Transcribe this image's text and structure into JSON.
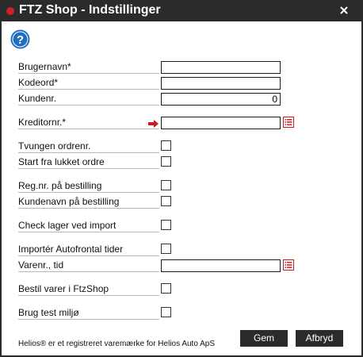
{
  "window": {
    "title": "FTZ Shop - Indstillinger",
    "close_icon": "close-icon",
    "accent_color": "#d0202a",
    "titlebar_color": "#2b2b2b"
  },
  "help": {
    "icon": "help-icon",
    "color": "#1f6fbf"
  },
  "form": {
    "username_label": "Brugernavn*",
    "username_value": "",
    "password_label": "Kodeord*",
    "password_value": "",
    "customer_no_label": "Kundenr.",
    "customer_no_value": "0",
    "creditor_no_label": "Kreditornr.*",
    "creditor_no_value": "",
    "forced_order_label": "Tvungen ordrenr.",
    "start_closed_label": "Start fra lukket ordre",
    "reg_no_label": "Reg.nr. på bestilling",
    "customer_name_label": "Kundenavn på bestilling",
    "check_stock_label": "Check lager ved import",
    "import_autofrontal_label": "Importér Autofrontal tider",
    "item_time_label": "Varenr., tid",
    "item_time_value": "",
    "order_ftzshop_label": "Bestil varer i FtzShop",
    "test_env_label": "Brug test miljø"
  },
  "footer": {
    "trademark_text": "Helios® er et registreret varemærke for Helios Auto ApS",
    "save_label": "Gem",
    "cancel_label": "Afbryd"
  }
}
